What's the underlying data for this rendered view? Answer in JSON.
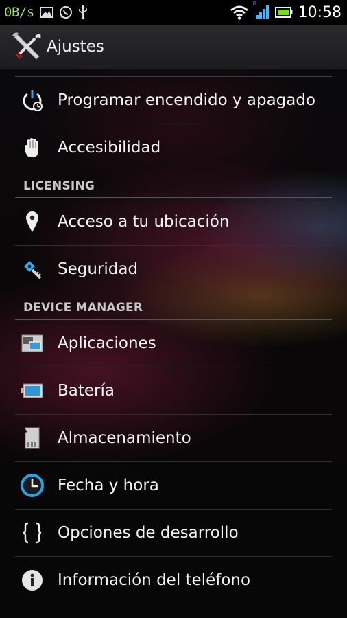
{
  "statusbar": {
    "net_speed": "0B/s",
    "time": "10:58",
    "roaming_indicator": "R",
    "icons": [
      "image-icon",
      "whatsapp-icon",
      "usb-icon",
      "wifi-icon",
      "signal-icon",
      "battery-icon"
    ],
    "battery_color": "#6fe02a"
  },
  "actionbar": {
    "title": "Ajustes",
    "icon": "settings-tools-icon"
  },
  "sections": [
    {
      "items": [
        {
          "label": "Programar encendido y apagado",
          "icon": "power-schedule-icon"
        },
        {
          "label": "Accesibilidad",
          "icon": "hand-icon"
        }
      ]
    },
    {
      "header": "LICENSING",
      "items": [
        {
          "label": "Acceso a tu ubicación",
          "icon": "location-pin-icon"
        },
        {
          "label": "Seguridad",
          "icon": "key-icon"
        }
      ]
    },
    {
      "header": "DEVICE MANAGER",
      "items": [
        {
          "label": "Aplicaciones",
          "icon": "apps-icon"
        },
        {
          "label": "Batería",
          "icon": "battery-icon"
        },
        {
          "label": "Almacenamiento",
          "icon": "sd-card-icon"
        },
        {
          "label": "Fecha y hora",
          "icon": "clock-icon"
        },
        {
          "label": "Opciones de desarrollo",
          "icon": "braces-icon"
        },
        {
          "label": "Información del teléfono",
          "icon": "info-icon"
        }
      ]
    }
  ]
}
